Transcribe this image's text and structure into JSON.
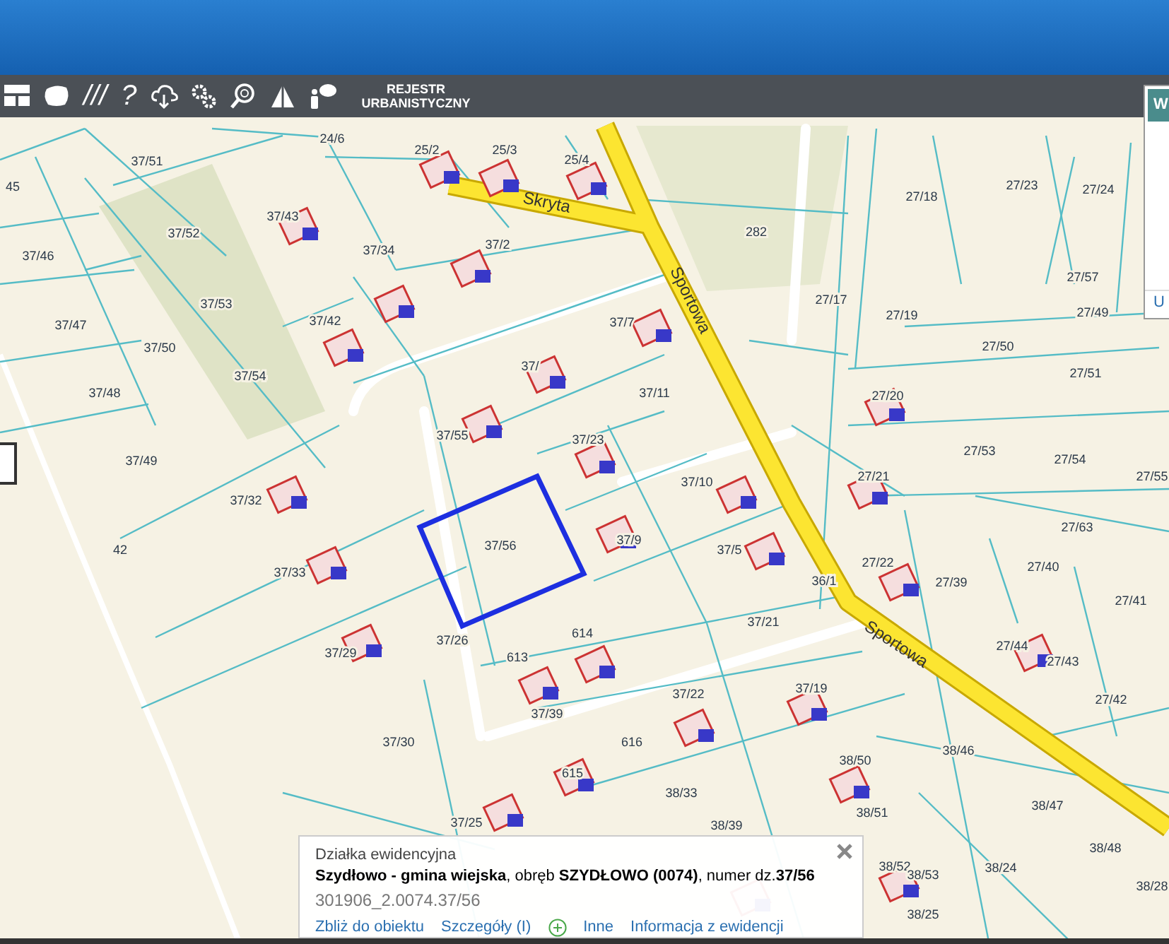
{
  "toolbar": {
    "items": [
      {
        "kind": "layout"
      },
      {
        "kind": "blob"
      },
      {
        "kind": "glyph",
        "text": "///"
      },
      {
        "kind": "glyph",
        "text": "?"
      },
      {
        "kind": "cloud"
      },
      {
        "kind": "gears"
      },
      {
        "kind": "zoom"
      },
      {
        "kind": "warning"
      },
      {
        "kind": "person"
      }
    ],
    "register_button": "REJESTR\nURBANISTYCZNY"
  },
  "side_panel": {
    "tab": "W",
    "footer": "U"
  },
  "map": {
    "streets": [
      "Skryta",
      "Sportowa",
      "Sportowa"
    ],
    "parcel_labels": [
      "45",
      "24/6",
      "25/2",
      "25/3",
      "25/4",
      "27/18",
      "27/23",
      "27/24",
      "37/51",
      "37/46",
      "37/43",
      "37/52",
      "37/34",
      "37/2",
      "282",
      "27/17",
      "27/19",
      "27/57",
      "27/49",
      "37/53",
      "37/42",
      "37/47",
      "37/50",
      "37/7",
      "37/",
      "27/50",
      "27/51",
      "37/54",
      "37/48",
      "37/11",
      "27/20",
      "37/55",
      "37/23",
      "27/53",
      "27/54",
      "27/55",
      "37/49",
      "37/32",
      "37/10",
      "27/21",
      "37/56",
      "37/9",
      "37/5",
      "27/63",
      "42",
      "37/33",
      "36/1",
      "27/22",
      "27/39",
      "27/40",
      "27/41",
      "37/26",
      "614",
      "37/21",
      "37/29",
      "613",
      "27/44",
      "27/43",
      "37/19",
      "37/22",
      "27/42",
      "37/39",
      "37/30",
      "616",
      "38/46",
      "38/50",
      "38/33",
      "615",
      "38/51",
      "38/47",
      "37/25",
      "38/39",
      "38/48",
      "38/24",
      "38/28",
      "38/52",
      "38/53",
      "38/25"
    ]
  },
  "popup": {
    "category": "Działka ewidencyjna",
    "title": "**Szydłowo - gmina wiejska**, obręb **SZYDŁOWO (0074)**, numer dz.**37/56**",
    "identifier": "301906_2.0074.37/56",
    "links": [
      {
        "kind": "link",
        "text": "Zbliż do obiektu"
      },
      {
        "kind": "link",
        "text": "Szczegóły (I)"
      },
      {
        "kind": "plus"
      },
      {
        "kind": "link",
        "text": "Inne"
      },
      {
        "kind": "link",
        "text": "Informacja z ewidencji"
      }
    ]
  }
}
